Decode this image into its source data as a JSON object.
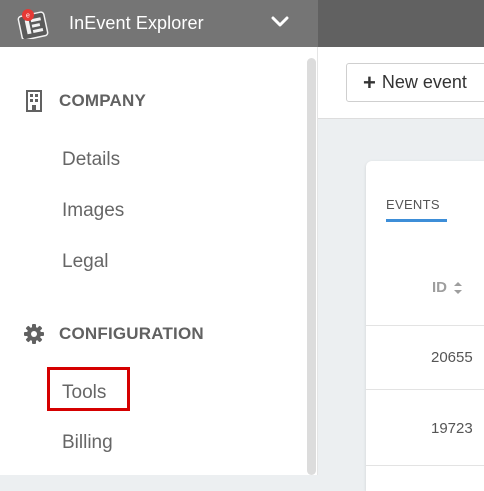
{
  "header": {
    "app_title": "InEvent Explorer",
    "logo_icon": "inevent-logo-icon",
    "chevron_icon": "chevron-down-icon"
  },
  "sidebar": {
    "sections": [
      {
        "label": "COMPANY",
        "icon": "building-icon",
        "items": [
          "Details",
          "Images",
          "Legal"
        ]
      },
      {
        "label": "CONFIGURATION",
        "icon": "gear-icon",
        "items": [
          "Tools",
          "Billing"
        ]
      }
    ],
    "highlighted_item": "Tools"
  },
  "toolbar": {
    "new_event_label": "New event",
    "new_event_icon": "plus-icon"
  },
  "events_card": {
    "tab_label": "EVENTS",
    "columns": [
      "ID"
    ],
    "rows": [
      {
        "id": "20655"
      },
      {
        "id": "19723"
      }
    ]
  },
  "colors": {
    "header_bg": "#757575",
    "accent_underline": "#3d8ed8",
    "highlight_border": "#d50000"
  }
}
